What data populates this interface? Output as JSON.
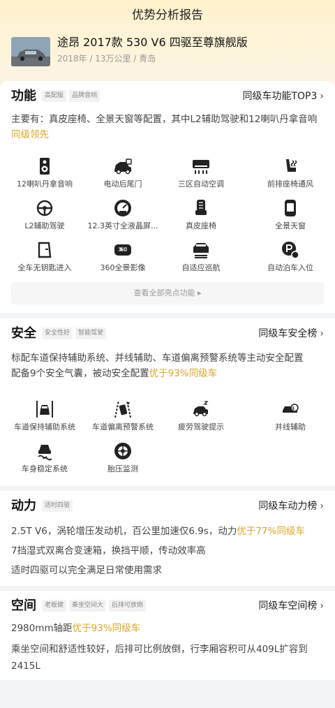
{
  "page_title": "优势分析报告",
  "car": {
    "name": "途昂 2017款 530 V6 四驱至尊旗舰版",
    "meta": "2018年 / 13万公里 / 青岛"
  },
  "function": {
    "title": "功能",
    "tags": [
      "高配版",
      "品牌音响"
    ],
    "link": "同级车功能TOP3",
    "desc_prefix": "主要有：真皮座椅、全景天窗等配置，其中L2辅助驾驶和12喇叭丹拿音响",
    "desc_highlight": "同级领先",
    "items": [
      {
        "label": "12喇叭丹拿音响",
        "icon": "speaker-icon"
      },
      {
        "label": "电动后尾门",
        "icon": "power-tailgate-icon"
      },
      {
        "label": "三区自动空调",
        "icon": "air-conditioner-icon"
      },
      {
        "label": "前排座椅通风",
        "icon": "seat-ventilation-icon"
      },
      {
        "label": "L2辅助驾驶",
        "icon": "steering-assist-icon"
      },
      {
        "label": "12.3英寸全液晶屏...",
        "icon": "lcd-gauge-icon"
      },
      {
        "label": "真皮座椅",
        "icon": "leather-seat-icon"
      },
      {
        "label": "全景天窗",
        "icon": "panoramic-sunroof-icon"
      },
      {
        "label": "全车无钥匙进入",
        "icon": "keyless-entry-icon"
      },
      {
        "label": "360全景影像",
        "icon": "camera-360-icon"
      },
      {
        "label": "自适应巡航",
        "icon": "adaptive-cruise-icon"
      },
      {
        "label": "自动泊车入位",
        "icon": "auto-parking-icon"
      }
    ],
    "view_all": "查看全部亮点功能"
  },
  "safety": {
    "title": "安全",
    "tags": [
      "安全性好",
      "智能驾驶"
    ],
    "link": "同级车安全榜",
    "desc_line1": "标配车道保持辅助系统、并线辅助、车道偏离预警系统等主动安全配置",
    "desc_line2_prefix": "配备9个安全气囊，被动安全配置",
    "desc_line2_highlight": "优于93%同级车",
    "items": [
      {
        "label": "车道保持辅助系统",
        "icon": "lane-keep-icon"
      },
      {
        "label": "车道偏离预警系统",
        "icon": "lane-departure-icon"
      },
      {
        "label": "疲劳驾驶提示",
        "icon": "fatigue-alert-icon"
      },
      {
        "label": "并线辅助",
        "icon": "blind-spot-icon"
      },
      {
        "label": "车身稳定系统",
        "icon": "stability-control-icon"
      },
      {
        "label": "胎压监测",
        "icon": "tire-pressure-icon"
      }
    ]
  },
  "power": {
    "title": "动力",
    "tags": [
      "适时四驱"
    ],
    "link": "同级车动力榜",
    "line1_prefix": "2.5T V6，涡轮增压发动机，百公里加速仅6.9s，动力",
    "line1_highlight": "优于77%同级车",
    "line2": "7挡湿式双离合变速箱，换挡平顺，传动效率高",
    "line3": "适时四驱可以完全满足日常使用需求"
  },
  "space": {
    "title": "空间",
    "tags": [
      "老板键",
      "乘坐空间大",
      "后排可放倒"
    ],
    "link": "同级车空间榜",
    "line1_prefix": "2980mm轴距",
    "line1_highlight": "优于93%同级车",
    "line2": "乘坐空间和舒适性较好，后排可比例放倒，行李厢容积可从409L扩容到2415L"
  },
  "colors": {
    "accent": "#d9a526",
    "icon": "#222222",
    "hero": "#fff2cc"
  }
}
